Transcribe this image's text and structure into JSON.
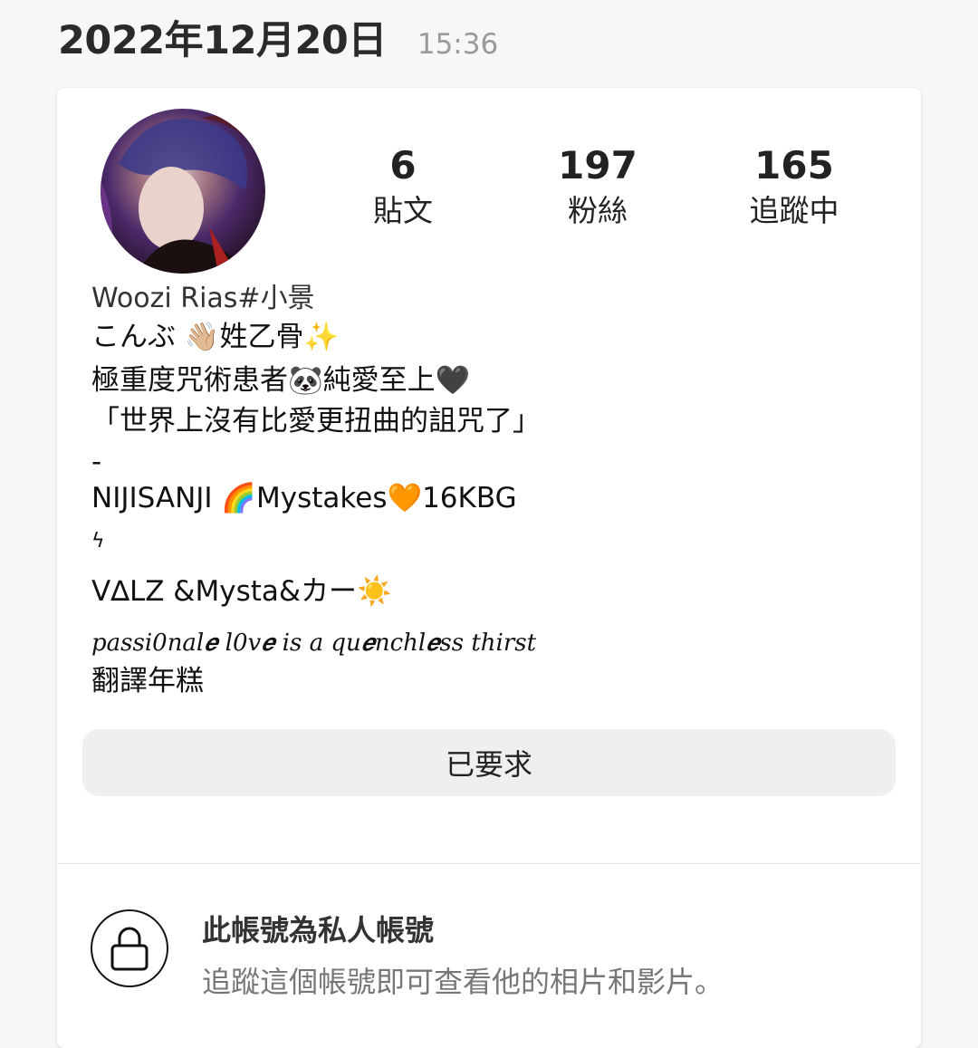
{
  "header": {
    "date": "2022年12月20日",
    "time": "15:36"
  },
  "profile": {
    "avatar_icon": "profile-avatar",
    "stats": [
      {
        "value": "6",
        "label": "貼文"
      },
      {
        "value": "197",
        "label": "粉絲"
      },
      {
        "value": "165",
        "label": "追蹤中"
      }
    ],
    "name": "Woozi Rias#小景",
    "bio_lines": [
      "こんぶ 👋🏼姓乙骨✨",
      "極重度咒術患者🐼純愛至上🖤",
      "「世界上沒有比愛更扭曲的詛咒了」",
      "-",
      "NIJISANJI 🌈Mystakes🧡16KBG",
      "ϟ",
      "V∆LZ &Mysta&カー☀️",
      "passi0nal𝒆 l0v𝒆 is a qu𝒆nchl𝒆ss thirst",
      "翻譯年糕"
    ],
    "request_button": "已要求"
  },
  "private": {
    "icon": "lock-icon",
    "title": "此帳號為私人帳號",
    "description": "追蹤這個帳號即可查看他的相片和影片。"
  }
}
